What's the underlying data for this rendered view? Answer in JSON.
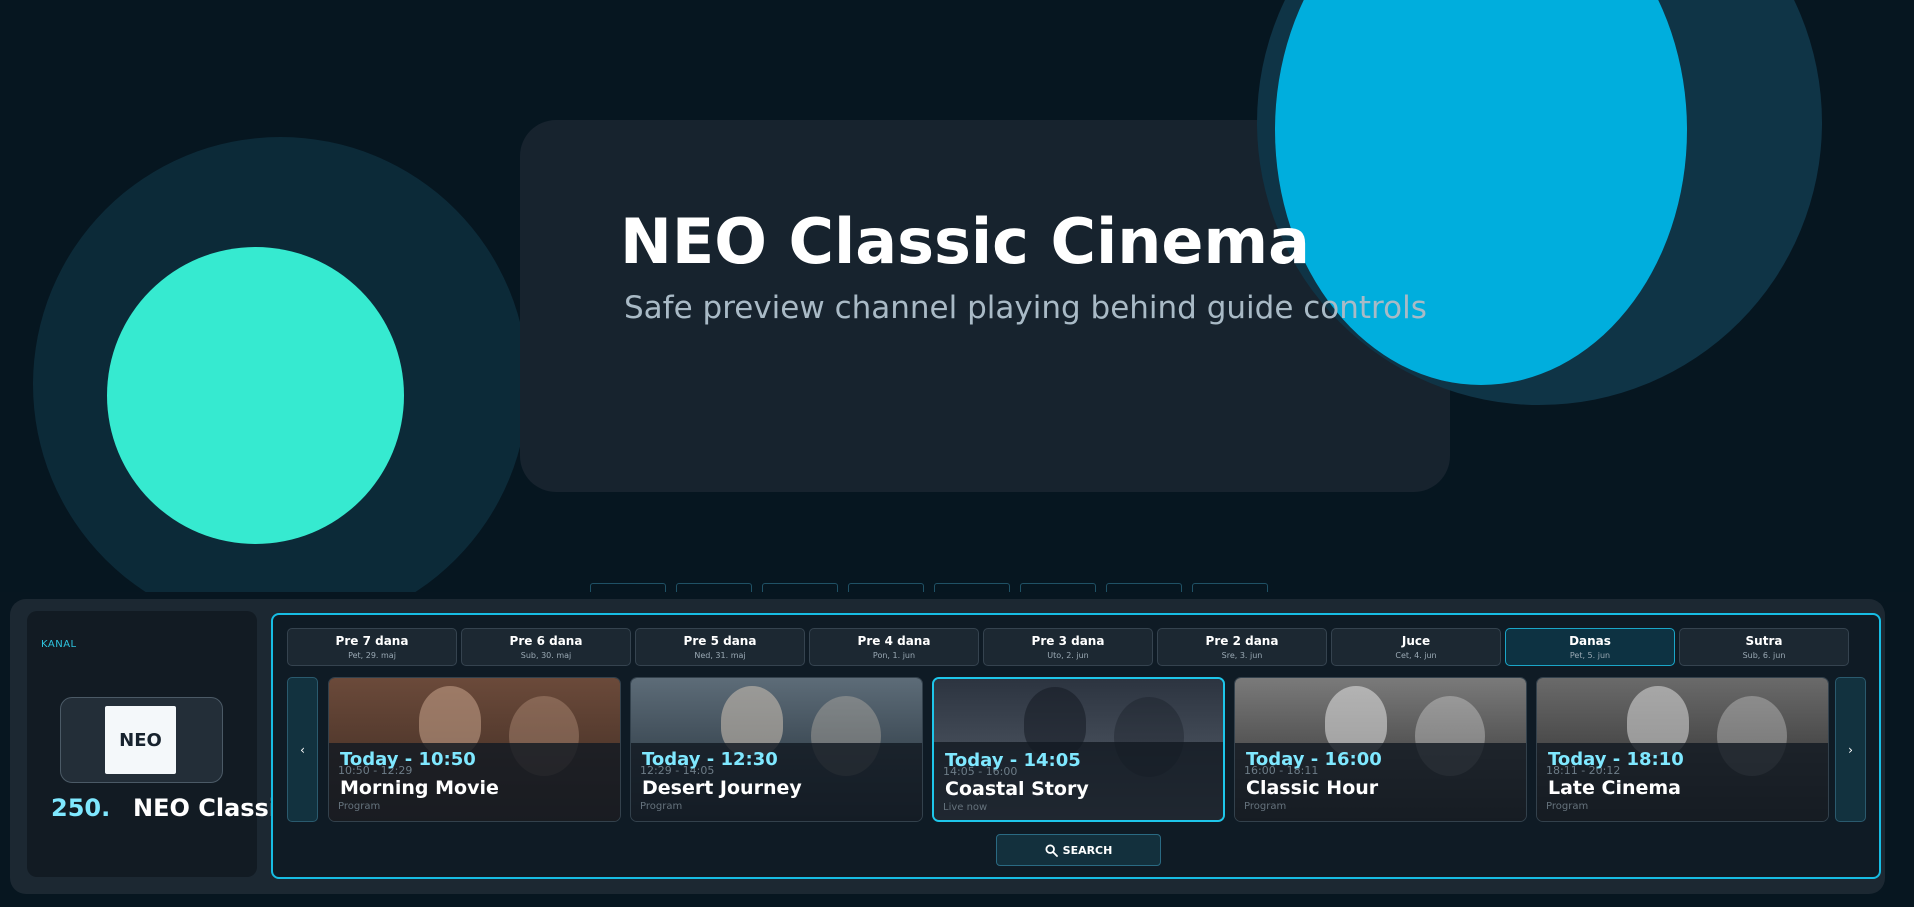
{
  "preview": {
    "title": "NEO Classic Cinema",
    "subtitle": "Safe preview channel playing behind guide controls"
  },
  "channel": {
    "label": "KANAL",
    "logo_text": "NEO",
    "number": "250.",
    "name": "NEO Classic"
  },
  "days": [
    {
      "label": "Pre 7 dana",
      "date": "Pet, 29. maj"
    },
    {
      "label": "Pre 6 dana",
      "date": "Sub, 30. maj"
    },
    {
      "label": "Pre 5 dana",
      "date": "Ned, 31. maj"
    },
    {
      "label": "Pre 4 dana",
      "date": "Pon, 1. jun"
    },
    {
      "label": "Pre 3 dana",
      "date": "Uto, 2. jun"
    },
    {
      "label": "Pre 2 dana",
      "date": "Sre, 3. jun"
    },
    {
      "label": "Juce",
      "date": "Cet, 4. jun"
    },
    {
      "label": "Danas",
      "date": "Pet, 5. jun",
      "active": true
    },
    {
      "label": "Sutra",
      "date": "Sub, 6. jun"
    }
  ],
  "programs": [
    {
      "time": "Today - 10:50",
      "title": "Morning Movie",
      "range": "10:50 - 12:29",
      "tag": "Program"
    },
    {
      "time": "Today - 12:30",
      "title": "Desert Journey",
      "range": "12:29 - 14:05",
      "tag": "Program"
    },
    {
      "time": "Today - 14:05",
      "title": "Coastal Story",
      "range": "14:05 - 16:00",
      "tag": "Live now",
      "active": true
    },
    {
      "time": "Today - 16:00",
      "title": "Classic Hour",
      "range": "16:00 - 18:11",
      "tag": "Program"
    },
    {
      "time": "Today - 18:10",
      "title": "Late Cinema",
      "range": "18:11 - 20:12",
      "tag": "Program"
    }
  ],
  "nav": {
    "prev": "‹",
    "next": "›"
  },
  "search": {
    "label": "SEARCH",
    "icon": "search-icon"
  },
  "colors": {
    "accent": "#17bde4",
    "time": "#7fe8ff",
    "green": "#36ead0",
    "blue": "#00b5e6"
  }
}
